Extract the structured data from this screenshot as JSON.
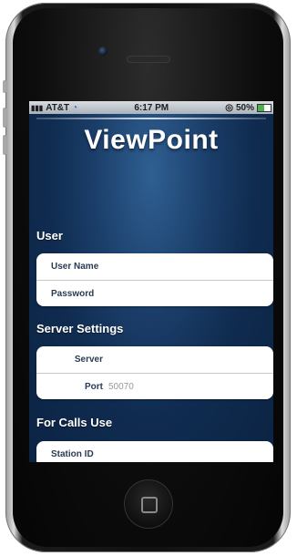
{
  "status_bar": {
    "carrier": "AT&T",
    "time": "6:17 PM",
    "battery": "50%"
  },
  "app": {
    "title": "ViewPoint"
  },
  "sections": {
    "user": {
      "label": "User",
      "fields": {
        "user_name": "User Name",
        "password": "Password"
      }
    },
    "server": {
      "label": "Server Settings",
      "fields": {
        "server": "Server",
        "port": "Port",
        "port_placeholder": "50070"
      }
    },
    "calls": {
      "label": "For Calls Use",
      "fields": {
        "station_id": "Station ID"
      }
    }
  },
  "colors": {
    "background": "#0f2b4f",
    "accent": "#2f5f92",
    "field_text": "#2a3a52"
  }
}
